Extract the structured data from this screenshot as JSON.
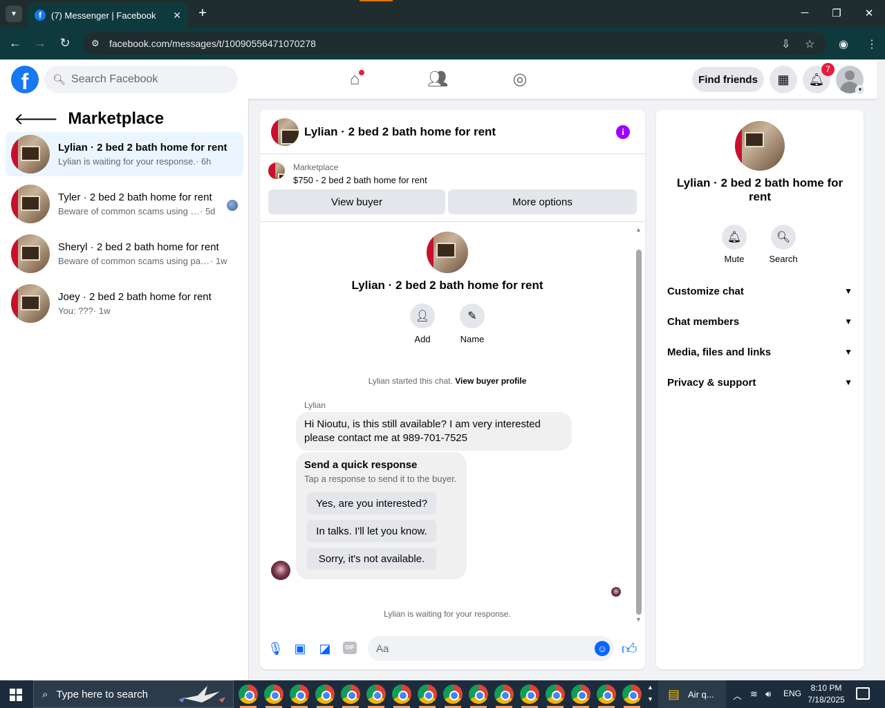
{
  "browser": {
    "tab_title": "(7) Messenger | Facebook",
    "tab_favicon": "f",
    "url": "facebook.com/messages/t/10090556471070278",
    "accent_color": "#0f3a3d"
  },
  "fb_header": {
    "logo": "f",
    "search_placeholder": "Search Facebook",
    "find_friends_label": "Find friends",
    "notifications_count": "7",
    "brand_color": "#1877f2"
  },
  "sidebar": {
    "title": "Marketplace",
    "conversations": [
      {
        "name": "Lylian · 2 bed 2 bath home for rent",
        "snippet": "Lylian is waiting for your response.",
        "time": " · 6h",
        "active": true
      },
      {
        "name": "Tyler · 2 bed 2 bath home for rent",
        "snippet": "Beware of common scams using p...",
        "time": " · 5d",
        "active": false
      },
      {
        "name": "Sheryl · 2 bed 2 bath home for rent",
        "snippet": "Beware of common scams using pay...",
        "time": " · 1w",
        "active": false
      },
      {
        "name": "Joey · 2 bed 2 bath home for rent",
        "snippet": "You: ???",
        "time": " · 1w",
        "active": false
      }
    ]
  },
  "chat": {
    "title": "Lylian · 2 bed 2 bath home for rent",
    "listing_label": "Marketplace",
    "listing_price": "$750 - 2 bed 2 bath home for rent",
    "view_buyer_label": "View buyer",
    "more_options_label": "More options",
    "intro_title": "Lylian · 2 bed 2 bath home for rent",
    "intro_add_label": "Add",
    "intro_name_label": "Name",
    "system_message": "Lylian started this chat.",
    "system_link": "View buyer profile",
    "sender_name": "Lylian",
    "message_text": "Hi Nioutu, is this still available? I am very interested please contact me at 989-701-7525",
    "quick_response_title": "Send a quick response",
    "quick_response_subtitle": "Tap a response to send it to the buyer.",
    "quick_responses": [
      "Yes, are you interested?",
      "In talks. I'll let you know.",
      "Sorry, it's not available."
    ],
    "waiting_text": "Lylian is waiting for your response.",
    "composer_placeholder": "Aa",
    "accent_color": "#0866ff"
  },
  "right_panel": {
    "title": "Lylian · 2 bed 2 bath home for rent",
    "mute_label": "Mute",
    "search_label": "Search",
    "sections": [
      "Customize chat",
      "Chat members",
      "Media, files and links",
      "Privacy & support"
    ]
  },
  "taskbar": {
    "search_placeholder": "Type here to search",
    "weather_text": "Air q...",
    "language": "ENG",
    "time": "8:10 PM",
    "date": "7/18/2025"
  }
}
